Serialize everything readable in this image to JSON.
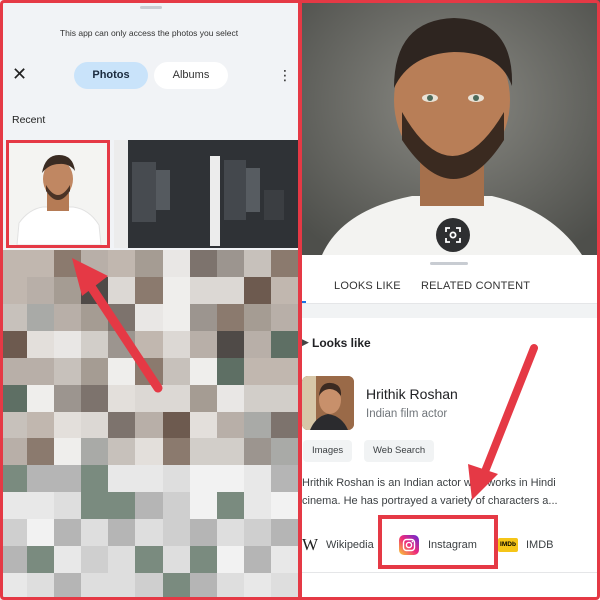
{
  "picker": {
    "notice": "This app can only access the photos you select",
    "close_icon": "close-icon",
    "tabs": [
      {
        "label": "Photos",
        "selected": true
      },
      {
        "label": "Albums",
        "selected": false
      }
    ],
    "menu_icon": "more-vert-icon",
    "section_label": "Recent"
  },
  "lens": {
    "search_icon": "lens-scan-icon",
    "tabs": [
      {
        "label": "LOOKS LIKE"
      },
      {
        "label": "RELATED CONTENT"
      }
    ],
    "section_title": "Looks like",
    "result": {
      "name": "Hrithik Roshan",
      "description": "Indian film actor",
      "chips": [
        "Images",
        "Web Search"
      ],
      "bio_line1": "Hrithik Roshan is an Indian actor who works in Hindi",
      "bio_line2": "cinema. He has portrayed a variety of characters a...",
      "sources": [
        {
          "label": "Wikipedia",
          "icon": "wikipedia-icon"
        },
        {
          "label": "Instagram",
          "icon": "instagram-icon"
        },
        {
          "label": "IMDB",
          "icon": "imdb-icon"
        }
      ],
      "imdb_logo_text": "IMDb"
    }
  },
  "colors": {
    "highlight": "#e53945",
    "selected_tab": "#c9e3fa"
  }
}
